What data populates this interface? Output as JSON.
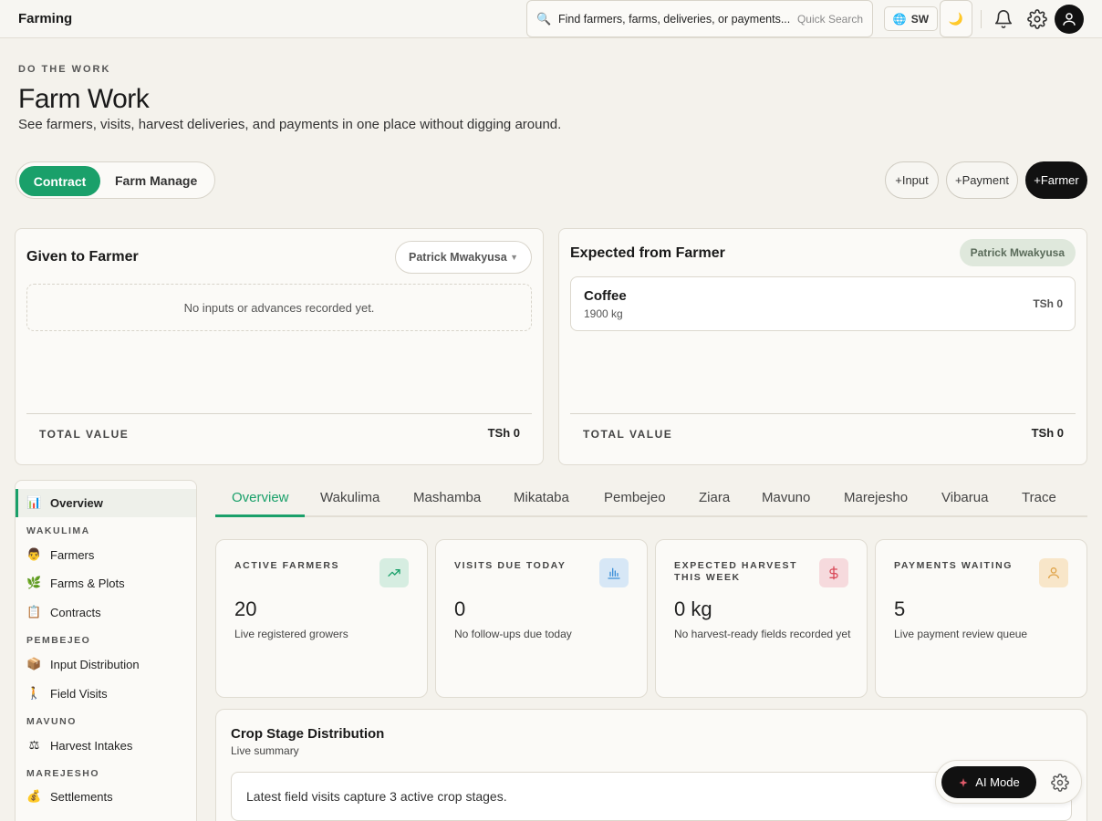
{
  "topbar": {
    "brand": "Farming",
    "search_placeholder": "Find farmers, farms, deliveries, or payments...",
    "quick_search": "Quick Search",
    "language": "SW",
    "theme_icon": "moon-icon"
  },
  "header": {
    "eyebrow": "DO THE WORK",
    "title": "Farm Work",
    "subtitle": "See farmers, visits, harvest deliveries, and payments in one place without digging around."
  },
  "mode_toggle": {
    "active": "Contract",
    "inactive": "Farm Manage"
  },
  "actions": {
    "input": "+Input",
    "payment": "+Payment",
    "farmer": "+Farmer"
  },
  "given_card": {
    "title": "Given to Farmer",
    "farmer_select": "Patrick Mwakyusa",
    "empty": "No inputs or advances recorded yet.",
    "total_label": "TOTAL VALUE",
    "total_value": "TSh 0"
  },
  "expected_card": {
    "title": "Expected from Farmer",
    "farmer_badge": "Patrick Mwakyusa",
    "crop": {
      "name": "Coffee",
      "qty": "1900 kg",
      "value": "TSh 0"
    },
    "total_label": "TOTAL VALUE",
    "total_value": "TSh 0"
  },
  "sidebar": {
    "overview": "Overview",
    "sections": [
      {
        "title": "WAKULIMA",
        "items": [
          "Farmers",
          "Farms & Plots",
          "Contracts"
        ]
      },
      {
        "title": "PEMBEJEO",
        "items": [
          "Input Distribution",
          "Field Visits"
        ]
      },
      {
        "title": "MAVUNO",
        "items": [
          "Harvest Intakes"
        ]
      },
      {
        "title": "MAREJESHO",
        "items": [
          "Settlements"
        ]
      }
    ]
  },
  "tabs": [
    "Overview",
    "Wakulima",
    "Mashamba",
    "Mikataba",
    "Pembejeo",
    "Ziara",
    "Mavuno",
    "Marejesho",
    "Vibarua",
    "Trace"
  ],
  "stats": [
    {
      "label": "ACTIVE FARMERS",
      "value": "20",
      "desc": "Live registered growers",
      "color": "#1aa06a"
    },
    {
      "label": "VISITS DUE TODAY",
      "value": "0",
      "desc": "No follow-ups due today",
      "color": "#3b8fd8"
    },
    {
      "label": "EXPECTED HARVEST THIS WEEK",
      "value": "0 kg",
      "desc": "No harvest-ready fields recorded yet",
      "color": "#d94b5a"
    },
    {
      "label": "PAYMENTS WAITING",
      "value": "5",
      "desc": "Live payment review queue",
      "color": "#e0a44a"
    }
  ],
  "crop_stage": {
    "title": "Crop Stage Distribution",
    "subtitle": "Live summary",
    "text": "Latest field visits capture 3 active crop stages."
  },
  "ai": {
    "label": "AI Mode"
  }
}
